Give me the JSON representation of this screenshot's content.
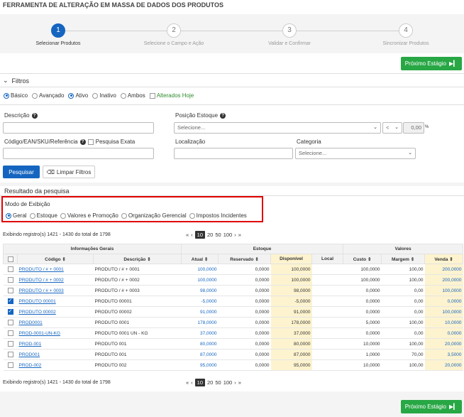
{
  "page_title": "FERRAMENTA DE ALTERAÇÃO EM MASSA DE DADOS DOS PRODUTOS",
  "wizard": {
    "steps": [
      {
        "number": "1",
        "label": "Selecionar Produtos"
      },
      {
        "number": "2",
        "label": "Selecione o Campo e Ação"
      },
      {
        "number": "3",
        "label": "Validar e Confirmar"
      },
      {
        "number": "4",
        "label": "Sincronizar Produtos"
      }
    ],
    "next_label": "Próximo Estágio"
  },
  "filters": {
    "header": "Filtros",
    "mode_options": [
      "Básico",
      "Avançado"
    ],
    "status_options": [
      "Ativo",
      "Inativo",
      "Ambos"
    ],
    "altered_today": "Alterados Hoje",
    "descricao_label": "Descrição",
    "codigo_label": "Código/EAN/SKU/Referência",
    "exact_search": "Pesquisa Exata",
    "posicao_label": "Posição Estoque",
    "posicao_placeholder": "Selecione...",
    "comparator": "<",
    "posicao_value": "0,00",
    "percent": "%",
    "localizacao_label": "Localização",
    "categoria_label": "Categoria",
    "categoria_placeholder": "Selecione...",
    "search_button": "Pesquisar",
    "clear_button": "Limpar Filtros"
  },
  "results": {
    "title": "Resultado da pesquisa",
    "display_mode_title": "Modo de Exibição",
    "display_modes": [
      "Geral",
      "Estoque",
      "Valores e Promoção",
      "Organização Gerencial",
      "Impostos Incidentes"
    ],
    "records_info": "Exibindo registro(s) 1421 - 1430 do total de 1798",
    "pager": {
      "first": "«",
      "prev": "‹",
      "sizes": [
        "10",
        "20",
        "50",
        "100"
      ],
      "next": "›",
      "last": "»"
    },
    "groups": {
      "general": "Informações Gerais",
      "stock": "Estoque",
      "values": "Valores"
    },
    "columns": [
      "Código",
      "Descrição",
      "Atual",
      "Reservado",
      "Disponível",
      "Local",
      "Custo",
      "Margem",
      "Venda"
    ],
    "rows": [
      {
        "codigo": "PRODUTO / # + 0001",
        "descricao": "PRODUTO / # + 0001",
        "atual": "100,0000",
        "reservado": "0,0000",
        "disponivel": "100,0000",
        "local": "",
        "custo": "100,0000",
        "margem": "100,00",
        "venda": "200,0000",
        "checked": false
      },
      {
        "codigo": "PRODUTO / # + 0002",
        "descricao": "PRODUTO / # + 0002",
        "atual": "100,0000",
        "reservado": "0,0000",
        "disponivel": "100,0000",
        "local": "",
        "custo": "100,0000",
        "margem": "100,00",
        "venda": "200,0000",
        "checked": false
      },
      {
        "codigo": "PRODUTO / # + 0003",
        "descricao": "PRODUTO / # + 0003",
        "atual": "98,0000",
        "reservado": "0,0000",
        "disponivel": "98,0000",
        "local": "",
        "custo": "0,0000",
        "margem": "0,00",
        "venda": "100,0000",
        "checked": false
      },
      {
        "codigo": "PRODUTO 00001",
        "descricao": "PRODUTO 00001",
        "atual": "-5,0000",
        "reservado": "0,0000",
        "disponivel": "-5,0000",
        "local": "",
        "custo": "0,0000",
        "margem": "0,00",
        "venda": "0,0000",
        "checked": true
      },
      {
        "codigo": "PRODUTO 00002",
        "descricao": "PRODUTO 00002",
        "atual": "91,0000",
        "reservado": "0,0000",
        "disponivel": "91,0000",
        "local": "",
        "custo": "0,0000",
        "margem": "0,00",
        "venda": "100,0000",
        "checked": true
      },
      {
        "codigo": "PROD0001",
        "descricao": "PRODUTO 0001",
        "atual": "178,0000",
        "reservado": "0,0000",
        "disponivel": "178,0000",
        "local": "",
        "custo": "5,0000",
        "margem": "100,00",
        "venda": "10,0000",
        "checked": false
      },
      {
        "codigo": "PROD-0001-UN-KG",
        "descricao": "PRODUTO 0001 UN - KG",
        "atual": "37,0000",
        "reservado": "0,0000",
        "disponivel": "37,0000",
        "local": "",
        "custo": "0,0000",
        "margem": "0,00",
        "venda": "0,0000",
        "checked": false
      },
      {
        "codigo": "PROD-001",
        "descricao": "PRODUTO 001",
        "atual": "80,0000",
        "reservado": "0,0000",
        "disponivel": "80,0000",
        "local": "",
        "custo": "10,0000",
        "margem": "100,00",
        "venda": "20,0000",
        "checked": false
      },
      {
        "codigo": "PROD001",
        "descricao": "PRODUTO 001",
        "atual": "87,0000",
        "reservado": "0,0000",
        "disponivel": "87,0000",
        "local": "",
        "custo": "1,0000",
        "margem": "70,00",
        "venda": "3,5000",
        "checked": false
      },
      {
        "codigo": "PROD-002",
        "descricao": "PRODUTO 002",
        "atual": "95,0000",
        "reservado": "0,0000",
        "disponivel": "95,0000",
        "local": "",
        "custo": "10,0000",
        "margem": "100,00",
        "venda": "20,0000",
        "checked": false
      }
    ]
  },
  "colors": {
    "primary": "#1565c0",
    "success": "#28a745",
    "highlight_border": "#e00000",
    "available_bg": "#fdf3cf"
  }
}
